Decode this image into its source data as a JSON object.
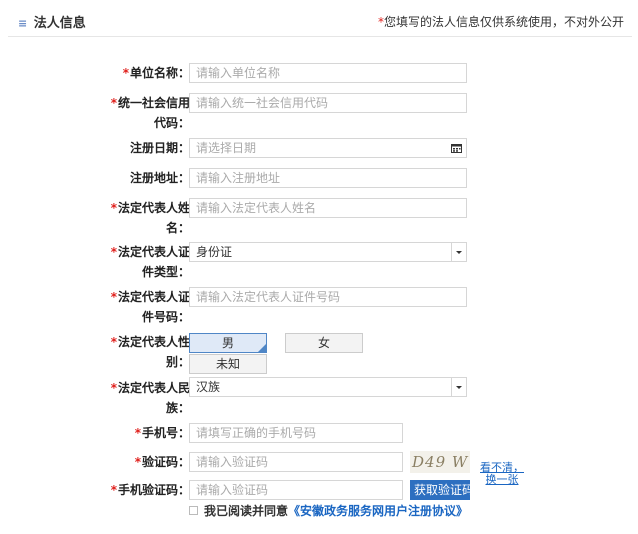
{
  "header": {
    "title": "法人信息",
    "menu_icon": "≡",
    "notice_star": "*",
    "notice": "您填写的法人信息仅供系统使用，不对外公开"
  },
  "required_mark": "*",
  "form": {
    "unit_name": {
      "label": "单位名称：",
      "placeholder": "请输入单位名称"
    },
    "credit_code": {
      "label_line1": "统一社会信用",
      "label_line2": "代码：",
      "placeholder": "请输入统一社会信用代码"
    },
    "reg_date": {
      "label": "注册日期：",
      "placeholder": "请选择日期"
    },
    "reg_address": {
      "label": "注册地址：",
      "placeholder": "请输入注册地址"
    },
    "legal_name": {
      "label_line1": "法定代表人姓",
      "label_line2": "名：",
      "placeholder": "请输入法定代表人姓名"
    },
    "id_type": {
      "label_line1": "法定代表人证",
      "label_line2": "件类型：",
      "value": "身份证"
    },
    "id_number": {
      "label_line1": "法定代表人证",
      "label_line2": "件号码：",
      "placeholder": "请输入法定代表人证件号码"
    },
    "gender": {
      "label_line1": "法定代表人性",
      "label_line2": "别：",
      "options": [
        "男",
        "女",
        "未知"
      ],
      "selected": "男"
    },
    "ethnicity": {
      "label_line1": "法定代表人民",
      "label_line2": "族：",
      "value": "汉族"
    },
    "phone": {
      "label": "手机号：",
      "placeholder": "请填写正确的手机号码"
    },
    "captcha": {
      "label": "验证码：",
      "placeholder": "请输入验证码",
      "image_text": "D49 W",
      "refresh_link": "看不清，换一张"
    },
    "sms_code": {
      "label": "手机验证码：",
      "placeholder": "请输入验证码",
      "button": "获取验证码"
    }
  },
  "agreement": {
    "text": "我已阅读并同意",
    "link": "《安徽政务服务网用户注册协议》"
  }
}
